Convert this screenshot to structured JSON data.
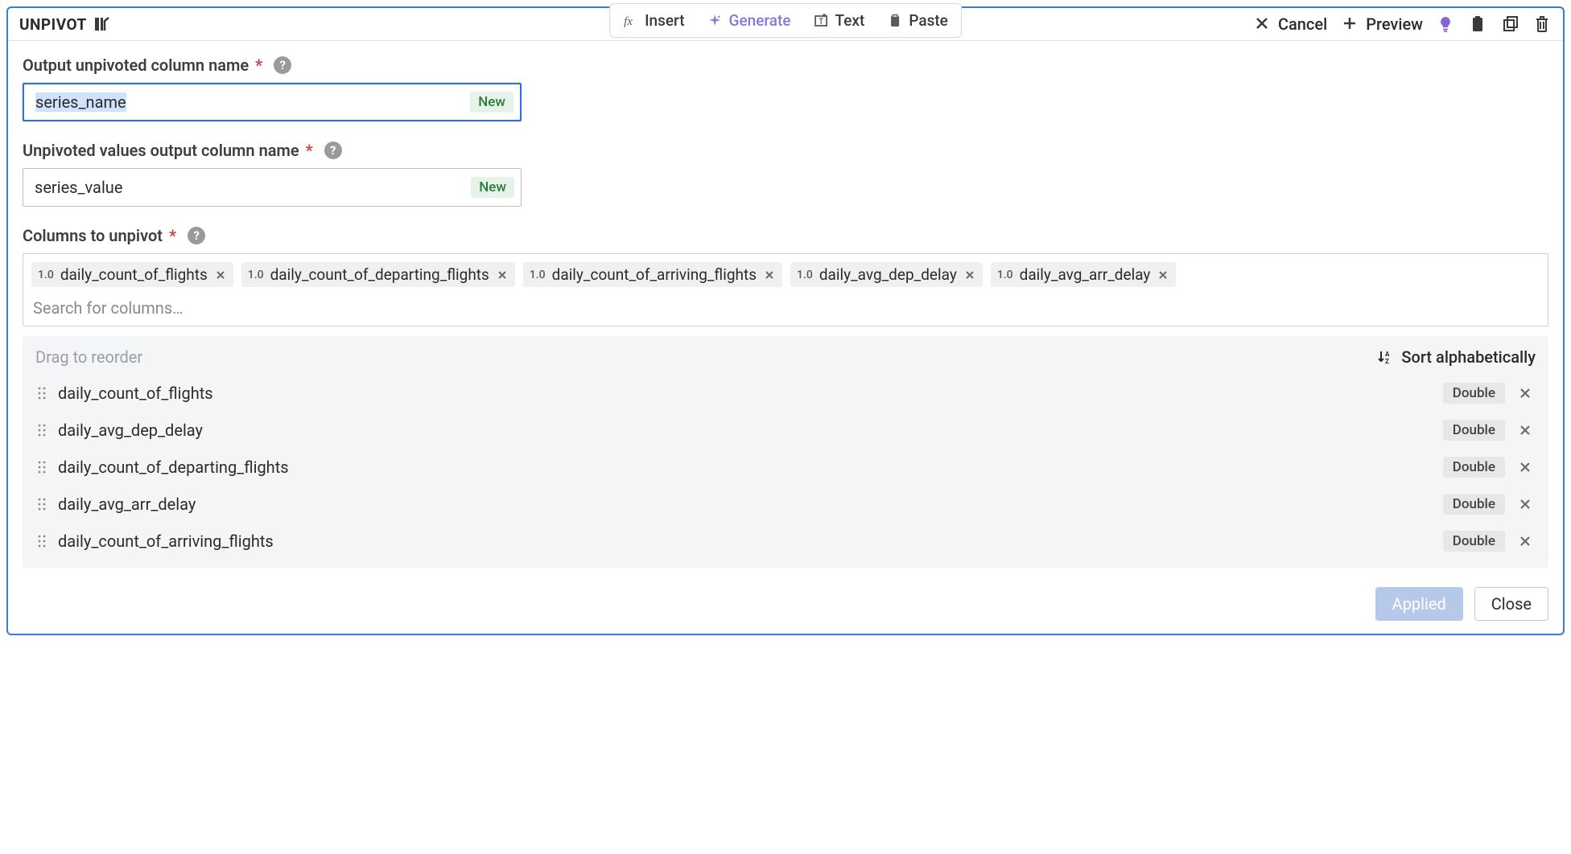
{
  "header": {
    "title": "UNPIVOT",
    "toolbar": {
      "insert": "Insert",
      "generate": "Generate",
      "text": "Text",
      "paste": "Paste"
    },
    "actions": {
      "cancel": "Cancel",
      "preview": "Preview"
    }
  },
  "fields": {
    "output_col": {
      "label": "Output unpivoted column name",
      "value": "series_name",
      "badge": "New"
    },
    "values_col": {
      "label": "Unpivoted values output column name",
      "value": "series_value",
      "badge": "New"
    },
    "columns": {
      "label": "Columns to unpivot",
      "search_placeholder": "Search for columns…",
      "chips": [
        {
          "type": "1.0",
          "name": "daily_count_of_flights"
        },
        {
          "type": "1.0",
          "name": "daily_count_of_departing_flights"
        },
        {
          "type": "1.0",
          "name": "daily_count_of_arriving_flights"
        },
        {
          "type": "1.0",
          "name": "daily_avg_dep_delay"
        },
        {
          "type": "1.0",
          "name": "daily_avg_arr_delay"
        }
      ]
    }
  },
  "reorder": {
    "hint": "Drag to reorder",
    "sort_label": "Sort alphabetically",
    "rows": [
      {
        "name": "daily_count_of_flights",
        "type": "Double"
      },
      {
        "name": "daily_avg_dep_delay",
        "type": "Double"
      },
      {
        "name": "daily_count_of_departing_flights",
        "type": "Double"
      },
      {
        "name": "daily_avg_arr_delay",
        "type": "Double"
      },
      {
        "name": "daily_count_of_arriving_flights",
        "type": "Double"
      }
    ]
  },
  "footer": {
    "applied": "Applied",
    "close": "Close"
  }
}
